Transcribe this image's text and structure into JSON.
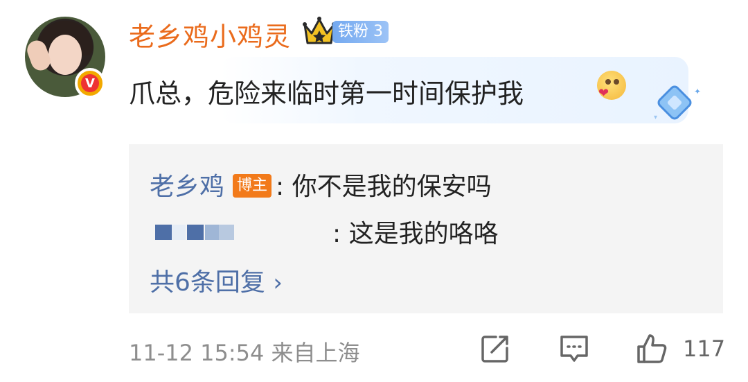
{
  "comment": {
    "username": "老乡鸡小鸡灵",
    "fan_badge": "铁粉 3",
    "text": "爪总，危险来临时第一时间保护我"
  },
  "replies": [
    {
      "name": "老乡鸡",
      "tag": "博主",
      "text": ": 你不是我的保安吗"
    },
    {
      "name": "",
      "tag": "",
      "text": ": 这是我的咯咯"
    }
  ],
  "more_replies": "共6条回复 ",
  "footer": {
    "timestamp": "11-12 15:54 来自上海",
    "like_count": "117"
  },
  "colors": {
    "username": "#ea6b1c",
    "reply_name": "#4e6fa7",
    "host_tag": "#f27a1a",
    "reply_bg": "#f4f4f4"
  },
  "icons": [
    "crown-icon",
    "verified-v-icon",
    "emoji-icon",
    "gem-icon",
    "repost-icon",
    "comment-icon",
    "like-icon",
    "chevron-right-icon"
  ]
}
